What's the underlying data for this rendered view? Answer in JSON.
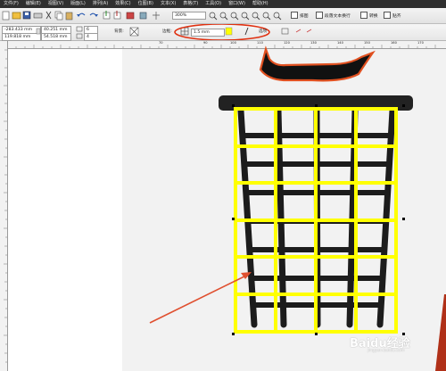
{
  "menu": [
    "文件(F)",
    "编辑(E)",
    "视图(V)",
    "版面(L)",
    "排列(A)",
    "效果(C)",
    "位图(B)",
    "文本(X)",
    "表格(T)",
    "工具(O)",
    "窗口(W)",
    "帮助(H)"
  ],
  "toolbar": {
    "zoom": "300%",
    "action_wrap": "排图",
    "action_wrap_text": "段落文本换行",
    "action_convert": "转换",
    "action_paste": "贴齐"
  },
  "props": {
    "pos_x": "-283.433 mm",
    "pos_y": "119.818 mm",
    "width": "40.251 mm",
    "height": "54.518 mm",
    "rows": "6",
    "cols": "4",
    "background_label": "背景:",
    "border_label": "边框:",
    "border_width": "1.5 mm",
    "options_label": "选项"
  },
  "ruler_top": [
    "70",
    "90",
    "100",
    "110",
    "120",
    "130",
    "140",
    "150",
    "160",
    "170"
  ],
  "watermark": "Baidu经验",
  "watermark_sub": "jingyan.baidu.com",
  "colors": {
    "menubar": "#2f2f2f",
    "highlight_ellipse": "#e03010",
    "grid_yellow": "#ffff00",
    "arrow": "#e05030",
    "border_swatch": "#ffff00"
  }
}
